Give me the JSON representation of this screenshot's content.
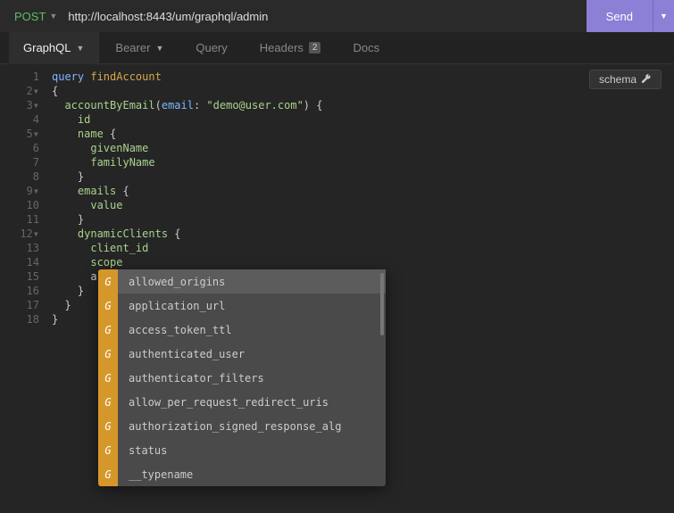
{
  "topbar": {
    "method": "POST",
    "url": "http://localhost:8443/um/graphql/admin",
    "send_label": "Send"
  },
  "tabs": {
    "main": "GraphQL",
    "items": [
      {
        "label": "Bearer",
        "caret": true
      },
      {
        "label": "Query"
      },
      {
        "label": "Headers",
        "badge": "2"
      },
      {
        "label": "Docs"
      }
    ]
  },
  "schema_button": "schema",
  "code": {
    "kw_query": "query",
    "op_name": "findAccount",
    "brace_open": "{",
    "fn_name": "accountByEmail",
    "arg_name": "email",
    "arg_value": "\"demo@user.com\"",
    "field_id": "id",
    "field_name": "name",
    "field_given": "givenName",
    "field_family": "familyName",
    "field_emails": "emails",
    "field_value": "value",
    "field_dyn": "dynamicClients",
    "field_client_id": "client_id",
    "field_scope": "scope",
    "partial": "a",
    "brace_close": "}"
  },
  "autocomplete": {
    "badge": "G",
    "items": [
      "allowed_origins",
      "application_url",
      "access_token_ttl",
      "authenticated_user",
      "authenticator_filters",
      "allow_per_request_redirect_uris",
      "authorization_signed_response_alg",
      "status",
      "__typename"
    ]
  },
  "gutter": {
    "lines": [
      "1",
      "2",
      "3",
      "4",
      "5",
      "6",
      "7",
      "8",
      "9",
      "10",
      "11",
      "12",
      "13",
      "14",
      "15",
      "16",
      "17",
      "18"
    ],
    "folds": [
      1,
      2,
      4,
      8,
      11
    ],
    "error_line": 14
  }
}
